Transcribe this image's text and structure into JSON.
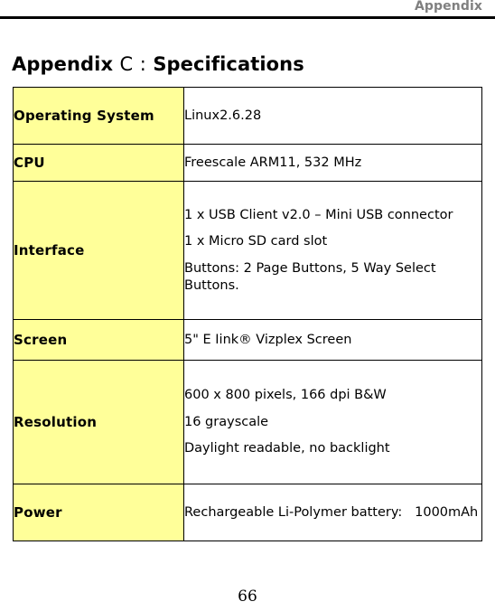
{
  "header": {
    "running_head": "Appendix"
  },
  "title": {
    "prefix": "Appendix",
    "letter": "C",
    "separator": ":",
    "subject": "Specifications"
  },
  "spec_table": {
    "rows": [
      {
        "label": "Operating System",
        "lines": [
          "Linux2.6.28"
        ]
      },
      {
        "label": "CPU",
        "lines": [
          "Freescale ARM11, 532 MHz"
        ]
      },
      {
        "label": "Interface",
        "lines": [
          "1 x USB Client v2.0 – Mini USB connector",
          "1 x Micro SD card slot",
          "Buttons: 2 Page Buttons, 5 Way Select Buttons."
        ]
      },
      {
        "label": "Screen",
        "lines": [
          "5\" E Iink® Vizplex Screen"
        ]
      },
      {
        "label": "Resolution",
        "lines": [
          "600 x 800 pixels, 166 dpi B&W",
          "16 grayscale",
          "Daylight readable, no backlight"
        ]
      },
      {
        "label": "Power",
        "lines": [
          "Rechargeable Li-Polymer battery:   1000mAh"
        ]
      }
    ]
  },
  "footer": {
    "page_number": "66"
  },
  "colors": {
    "label_cell_background": "#ffff99",
    "header_text": "#808080",
    "rule": "#000000",
    "body_text": "#000000"
  }
}
